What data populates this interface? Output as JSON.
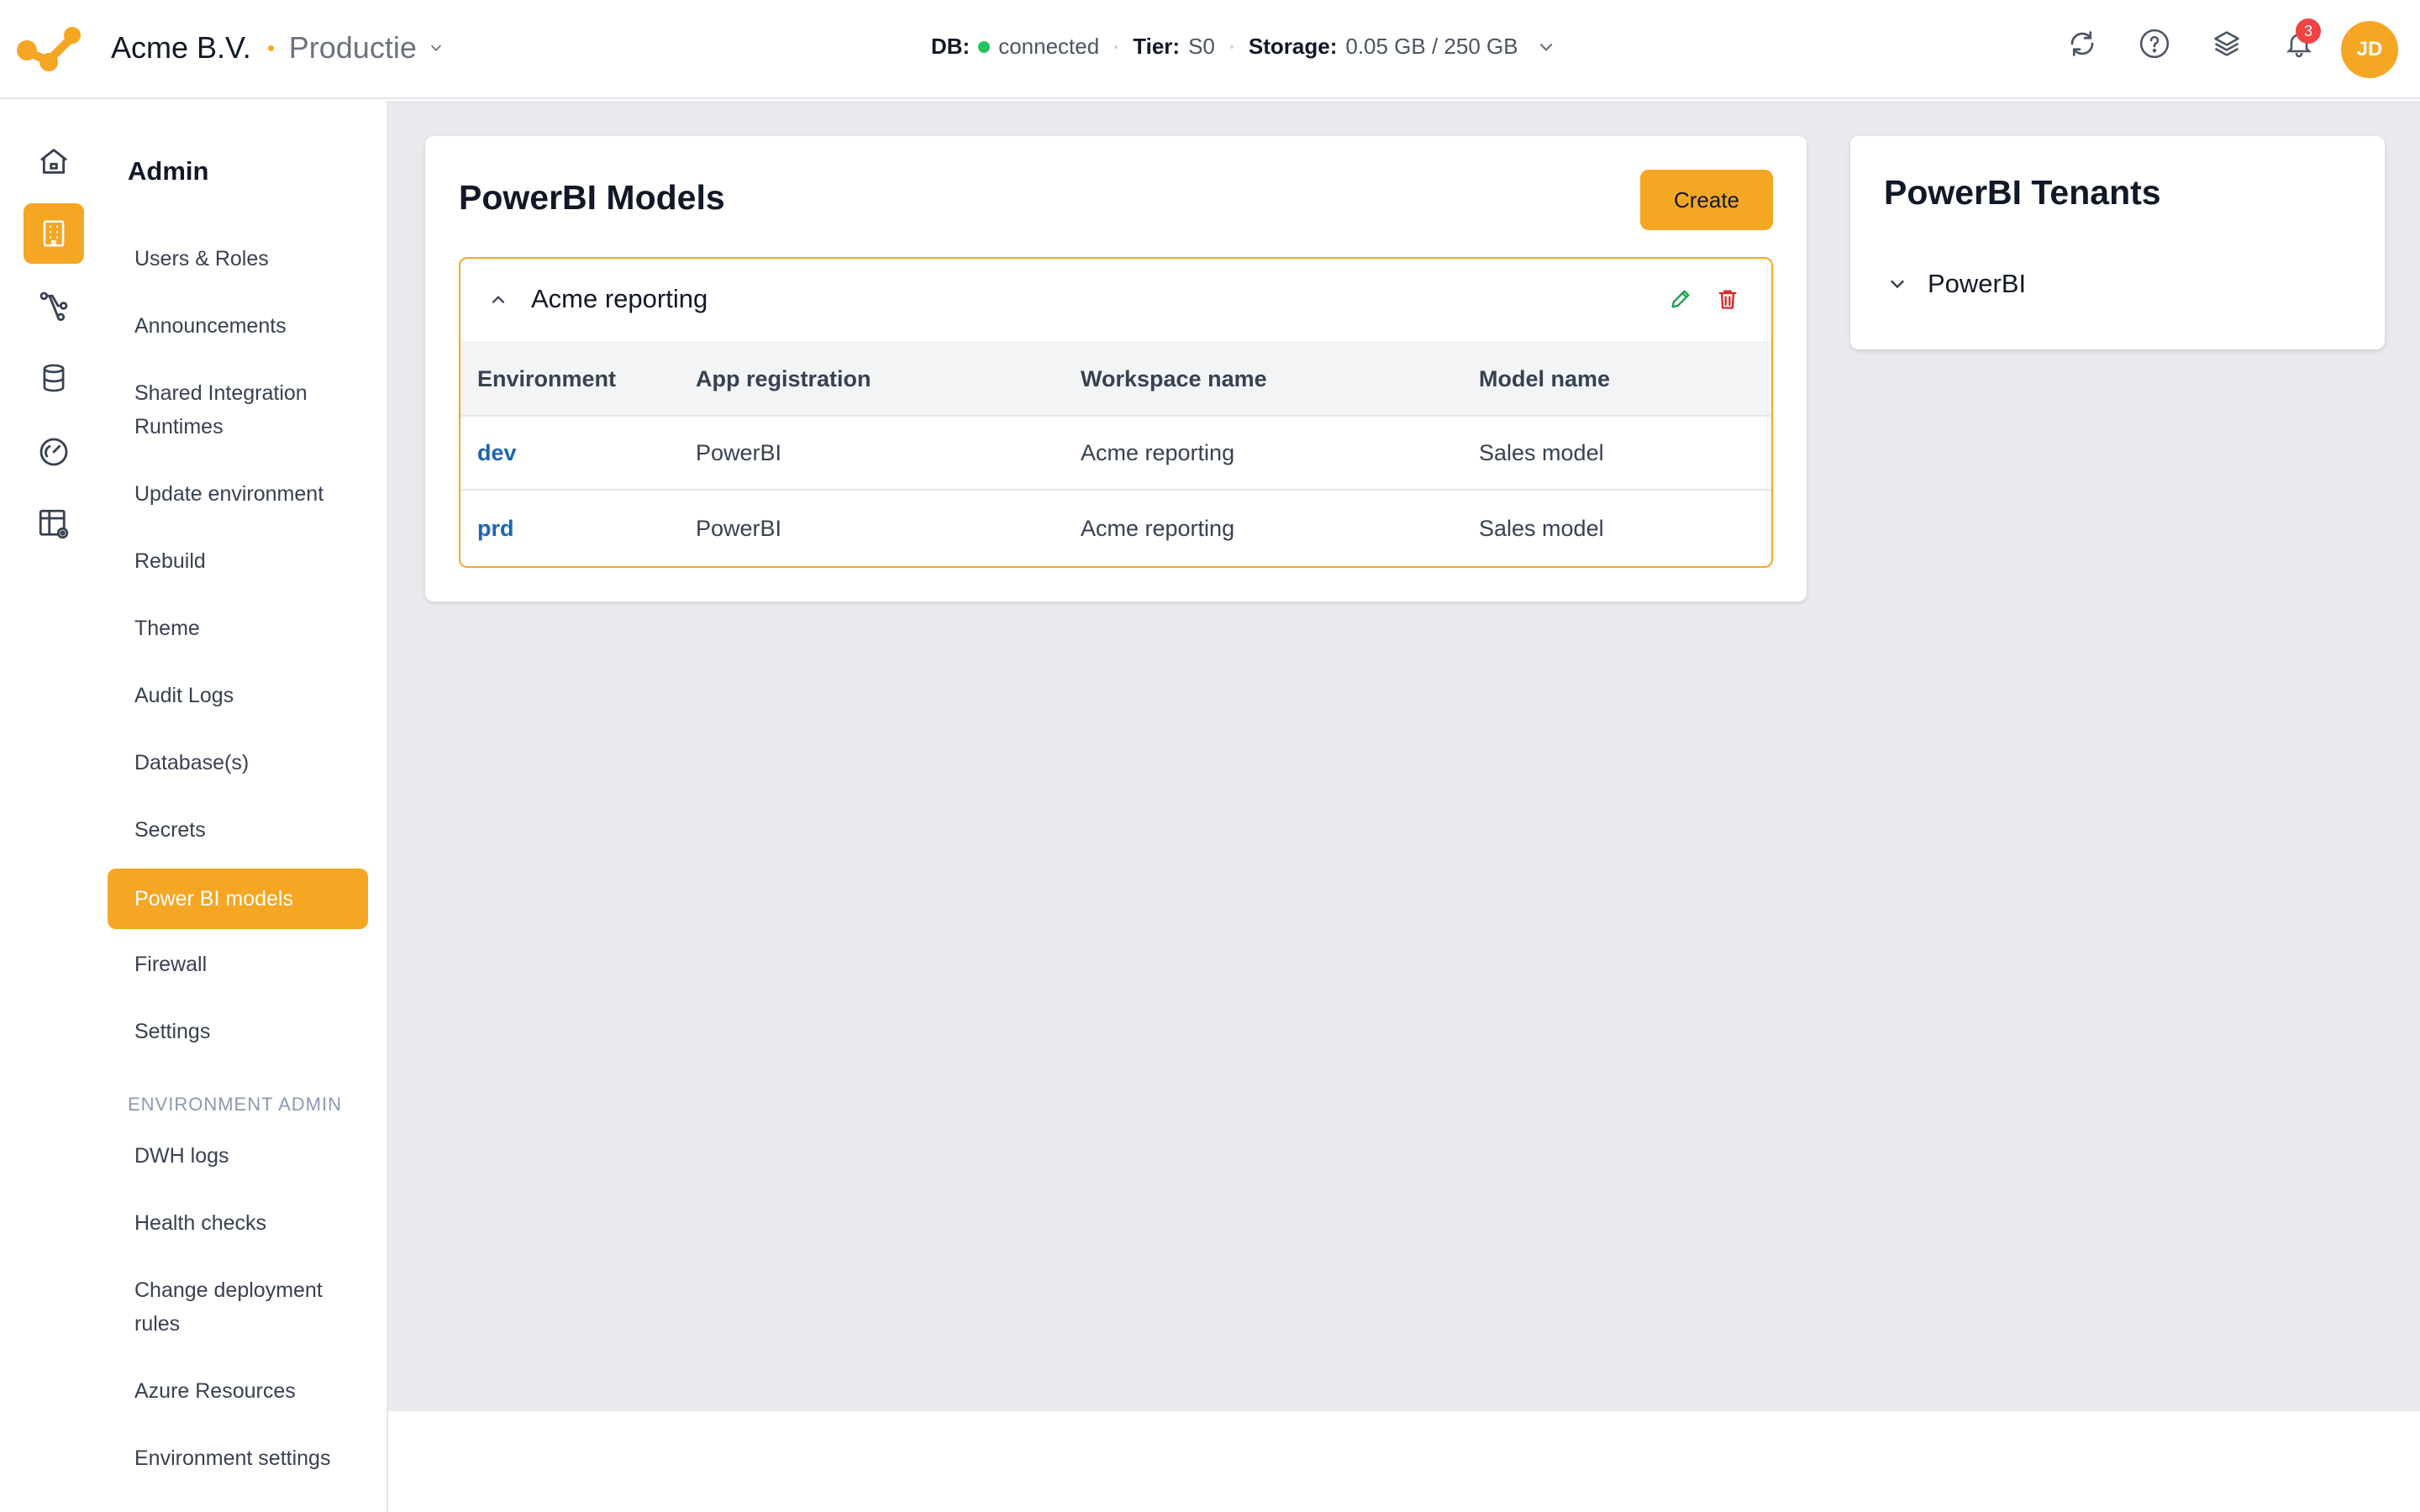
{
  "header": {
    "org_name": "Acme B.V.",
    "environment": "Productie",
    "db_label": "DB:",
    "db_status": "connected",
    "tier_label": "Tier:",
    "tier_value": "S0",
    "storage_label": "Storage:",
    "storage_value": "0.05 GB / 250 GB",
    "notifications_count": "3",
    "avatar_initials": "JD",
    "icons": [
      "refresh-icon",
      "help-icon",
      "layers-icon",
      "bell-icon"
    ]
  },
  "rail": {
    "items": [
      "home-icon",
      "admin-building-icon",
      "pipeline-icon",
      "database-icon",
      "dashboard-gauge-icon",
      "table-settings-icon"
    ],
    "active": "admin-building-icon"
  },
  "sidebar": {
    "heading": "Admin",
    "items": [
      {
        "label": "Users & Roles"
      },
      {
        "label": "Announcements"
      },
      {
        "label": "Shared Integration Runtimes"
      },
      {
        "label": "Update environment"
      },
      {
        "label": "Rebuild"
      },
      {
        "label": "Theme"
      },
      {
        "label": "Audit Logs"
      },
      {
        "label": "Database(s)"
      },
      {
        "label": "Secrets"
      },
      {
        "label": "Power BI models"
      },
      {
        "label": "Firewall"
      },
      {
        "label": "Settings"
      }
    ],
    "active_item": "Power BI models",
    "section_label": "ENVIRONMENT ADMIN",
    "env_items": [
      {
        "label": "DWH logs"
      },
      {
        "label": "Health checks"
      },
      {
        "label": "Change deployment rules"
      },
      {
        "label": "Azure Resources"
      },
      {
        "label": "Environment settings"
      }
    ]
  },
  "models": {
    "title": "PowerBI Models",
    "create_label": "Create",
    "group": {
      "name": "Acme reporting",
      "columns": [
        "Environment",
        "App registration",
        "Workspace name",
        "Model name"
      ],
      "rows": [
        {
          "environment": "dev",
          "app_registration": "PowerBI",
          "workspace": "Acme reporting",
          "model": "Sales model"
        },
        {
          "environment": "prd",
          "app_registration": "PowerBI",
          "workspace": "Acme reporting",
          "model": "Sales model"
        }
      ]
    }
  },
  "tenants": {
    "title": "PowerBI Tenants",
    "items": [
      {
        "label": "PowerBI"
      }
    ]
  },
  "colors": {
    "accent": "#f5a623",
    "link": "#1d64b3",
    "connected": "#22c55e",
    "danger": "#dc2626",
    "edit": "#16a34a",
    "main_bg": "#e9eaed"
  }
}
